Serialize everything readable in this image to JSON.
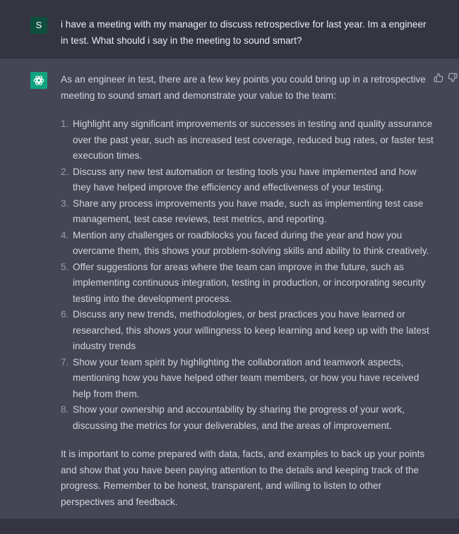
{
  "user_message": {
    "avatar_letter": "S",
    "text": "i have a meeting with my manager to discuss retrospective for last year. Im a engineer in test. What should i say in the meeting to sound smart?"
  },
  "assistant_message": {
    "avatar_icon": "openai-logo-icon",
    "intro": "As an engineer in test, there are a few key points you could bring up in a retrospective meeting to sound smart and demonstrate your value to the team:",
    "items": [
      {
        "num": "1.",
        "text": "Highlight any significant improvements or successes in testing and quality assurance over the past year, such as increased test coverage, reduced bug rates, or faster test execution times."
      },
      {
        "num": "2.",
        "text": "Discuss any new test automation or testing tools you have implemented and how they have helped improve the efficiency and effectiveness of your testing."
      },
      {
        "num": "3.",
        "text": "Share any process improvements you have made, such as implementing test case management, test case reviews, test metrics, and reporting."
      },
      {
        "num": "4.",
        "text": "Mention any challenges or roadblocks you faced during the year and how you overcame them, this shows your problem-solving skills and ability to think creatively."
      },
      {
        "num": "5.",
        "text": "Offer suggestions for areas where the team can improve in the future, such as implementing continuous integration, testing in production, or incorporating security testing into the development process."
      },
      {
        "num": "6.",
        "text": "Discuss any new trends, methodologies, or best practices you have learned or researched, this shows your willingness to keep learning and keep up with the latest industry trends"
      },
      {
        "num": "7.",
        "text": "Show your team spirit by highlighting the collaboration and teamwork aspects, mentioning how you have helped other team members, or how you have received help from them."
      },
      {
        "num": "8.",
        "text": "Show your ownership and accountability by sharing the progress of your work, discussing the metrics for your deliverables, and the areas of improvement."
      }
    ],
    "outro": "It is important to come prepared with data, facts, and examples to back up your points and show that you have been paying attention to the details and keeping track of the progress. Remember to be honest, transparent, and willing to listen to other perspectives and feedback."
  },
  "feedback": {
    "up_icon": "thumbs-up-icon",
    "down_icon": "thumbs-down-icon"
  },
  "colors": {
    "user_bg": "#343541",
    "assistant_bg": "#444654",
    "user_avatar": "#0f4f3e",
    "assistant_avatar": "#10a37f",
    "text": "#d1d5db"
  }
}
